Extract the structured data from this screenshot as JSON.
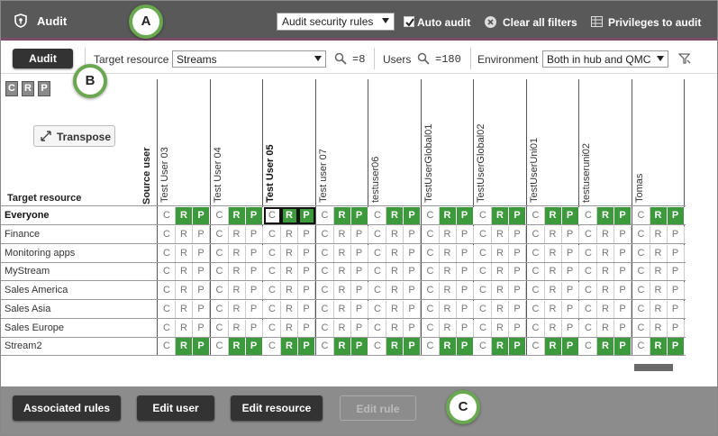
{
  "header": {
    "title": "Audit",
    "security_select": "Audit security rules",
    "auto_audit_label": "Auto audit",
    "auto_audit_checked": true,
    "clear_filters_label": "Clear all filters",
    "privileges_label": "Privileges to audit"
  },
  "callouts": {
    "a": "A",
    "b": "B",
    "c": "C"
  },
  "toolbar": {
    "audit_label": "Audit",
    "target_resource_label": "Target resource",
    "target_resource_value": "Streams",
    "target_count": "=8",
    "users_label": "Users",
    "users_count": "=180",
    "environment_label": "Environment",
    "environment_value": "Both in hub and QMC"
  },
  "crp_buttons": [
    "C",
    "R",
    "P"
  ],
  "transpose_label": "Transpose",
  "grid_headers": {
    "target_resource": "Target resource",
    "source_user": "Source user"
  },
  "users": [
    {
      "name": "Test User 03",
      "bold": false
    },
    {
      "name": "Test User 04",
      "bold": false
    },
    {
      "name": "Test User 05",
      "bold": true
    },
    {
      "name": "Test user 07",
      "bold": false
    },
    {
      "name": "testuser06",
      "bold": false
    },
    {
      "name": "TestUserGlobal01",
      "bold": false
    },
    {
      "name": "TestUserGlobal02",
      "bold": false
    },
    {
      "name": "TestUserUni01",
      "bold": false
    },
    {
      "name": "testuseruni02",
      "bold": false
    },
    {
      "name": "Tomas",
      "bold": false
    }
  ],
  "resources": [
    {
      "name": "Everyone",
      "bold": true,
      "granted": true
    },
    {
      "name": "Finance",
      "bold": false,
      "granted": false
    },
    {
      "name": "Monitoring apps",
      "bold": false,
      "granted": false
    },
    {
      "name": "MyStream",
      "bold": false,
      "granted": false
    },
    {
      "name": "Sales America",
      "bold": false,
      "granted": false
    },
    {
      "name": "Sales Asia",
      "bold": false,
      "granted": false
    },
    {
      "name": "Sales Europe",
      "bold": false,
      "granted": false
    },
    {
      "name": "Stream2",
      "bold": false,
      "granted": true
    }
  ],
  "privilege_letters": [
    "C",
    "R",
    "P"
  ],
  "bottom": {
    "associated_rules": "Associated rules",
    "edit_user": "Edit user",
    "edit_resource": "Edit resource",
    "edit_rule": "Edit rule"
  },
  "colors": {
    "granted": "#3c9a3c",
    "topbar": "#595959",
    "accent": "#7d4b6a",
    "callout_ring": "#6aa84f"
  }
}
